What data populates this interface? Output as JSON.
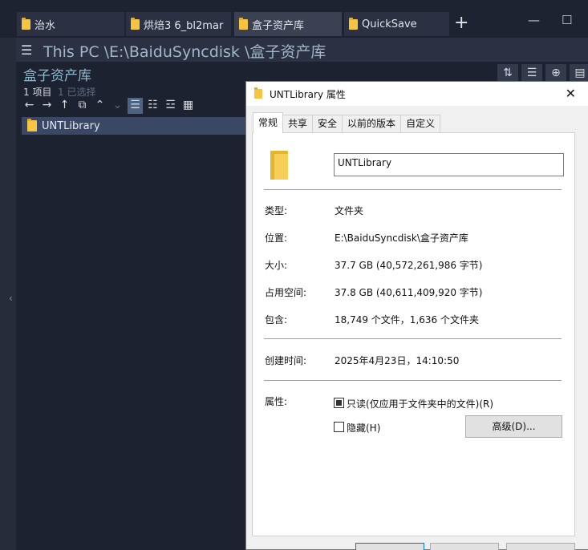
{
  "tabs": [
    {
      "label": "治水"
    },
    {
      "label": "烘焙3 6_bl2mar"
    },
    {
      "label": "盒子资产库"
    },
    {
      "label": "QuickSave"
    }
  ],
  "window": {
    "minimize": "—",
    "maximize": "☐"
  },
  "address": {
    "path": "This PC \\E:\\BaiduSyncdisk \\盒子资产库"
  },
  "pane": {
    "title": "盒子资产库",
    "count": "1 项目",
    "selected": "1 已选择",
    "items": [
      {
        "name": "UNTLibrary"
      }
    ]
  },
  "dialog": {
    "title": "UNTLibrary 属性",
    "tabs": [
      "常规",
      "共享",
      "安全",
      "以前的版本",
      "自定义"
    ],
    "name_value": "UNTLibrary",
    "props": {
      "type_label": "类型:",
      "type_value": "文件夹",
      "location_label": "位置:",
      "location_value": "E:\\BaiduSyncdisk\\盒子资产库",
      "size_label": "大小:",
      "size_value": "37.7 GB (40,572,261,986 字节)",
      "disk_label": "占用空间:",
      "disk_value": "37.8 GB (40,611,409,920 字节)",
      "contains_label": "包含:",
      "contains_value": "18,749 个文件，1,636 个文件夹",
      "created_label": "创建时间:",
      "created_value": "2025年4月23日，14:10:50",
      "attr_label": "属性:",
      "readonly_label": "只读(仅应用于文件夹中的文件)(R)",
      "hidden_label": "隐藏(H)",
      "advanced_label": "高级(D)..."
    }
  }
}
